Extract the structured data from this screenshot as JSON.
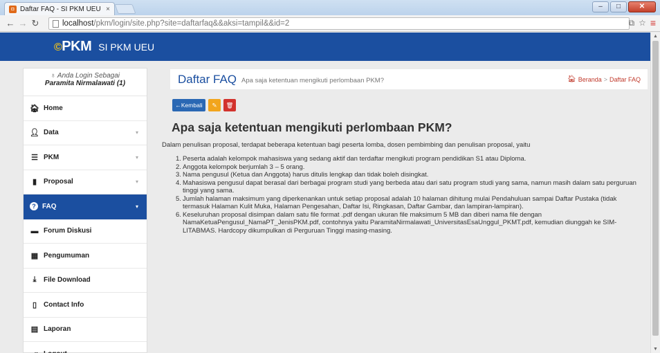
{
  "browser": {
    "tab_title": "Daftar FAQ - SI PKM UEU",
    "tab_close": "×",
    "url_host": "localhost",
    "url_rest": "/pkm/login/site.php?site=daftarfaq&&aksi=tampil&&id=2"
  },
  "header": {
    "logo_text": "PKM",
    "app_title": "SI PKM UEU"
  },
  "sidebar": {
    "login_as": "Anda Login Sebagai",
    "user_name": "Paramita Nirmalawati (1)",
    "items": [
      {
        "label": "Home",
        "icon": "home-icon",
        "caret": false,
        "active": false
      },
      {
        "label": "Data",
        "icon": "user-icon",
        "caret": true,
        "active": false
      },
      {
        "label": "PKM",
        "icon": "list-icon",
        "caret": true,
        "active": false
      },
      {
        "label": "Proposal",
        "icon": "book-icon",
        "caret": true,
        "active": false
      },
      {
        "label": "FAQ",
        "icon": "question-icon",
        "caret": true,
        "active": true
      },
      {
        "label": "Forum Diskusi",
        "icon": "comment-icon",
        "caret": false,
        "active": false
      },
      {
        "label": "Pengumuman",
        "icon": "grid-icon",
        "caret": false,
        "active": false
      },
      {
        "label": "File Download",
        "icon": "download-icon",
        "caret": false,
        "active": false
      },
      {
        "label": "Contact Info",
        "icon": "phone-icon",
        "caret": false,
        "active": false
      },
      {
        "label": "Laporan",
        "icon": "report-icon",
        "caret": false,
        "active": false
      },
      {
        "label": "Logout",
        "icon": "logout-icon",
        "caret": false,
        "active": false
      }
    ]
  },
  "content_header": {
    "title": "Daftar FAQ",
    "subtitle": "Apa saja ketentuan mengikuti perlombaan PKM?",
    "breadcrumb_home": "Beranda",
    "breadcrumb_sep": ">",
    "breadcrumb_current": "Daftar FAQ"
  },
  "actions": {
    "back_label": "Kembali"
  },
  "faq": {
    "question": "Apa saja ketentuan mengikuti perlombaan PKM?",
    "intro": "Dalam penulisan proposal, terdapat beberapa ketentuan bagi peserta lomba, dosen pembimbing dan penulisan proposal, yaitu",
    "points": [
      {
        "num": "1.",
        "text": "Peserta adalah kelompok mahasiswa yang sedang aktif dan terdaftar mengikuti program pendidikan S1 atau Diploma."
      },
      {
        "num": "2.",
        "text": "Anggota kelompok berjumlah 3 – 5 orang."
      },
      {
        "num": "3.",
        "text": "Nama pengusul (Ketua dan Anggota) harus ditulis lengkap dan tidak boleh disingkat."
      },
      {
        "num": "4.",
        "text": "Mahasiswa pengusul dapat berasal dari berbagai program studi yang berbeda atau dari satu program studi yang sama, namun masih dalam satu perguruan tinggi yang sama."
      },
      {
        "num": "5.",
        "text": "Jumlah halaman maksimum yang diperkenankan untuk setiap proposal adalah 10 halaman dihitung mulai Pendahuluan sampai Daftar Pustaka (tidak termasuk Halaman Kulit Muka, Halaman Pengesahan, Daftar Isi, Ringkasan, Daftar Gambar, dan lampiran-lampiran)."
      },
      {
        "num": "6.",
        "text": "Keseluruhan proposal disimpan dalam satu file format .pdf dengan ukuran file maksimum 5 MB dan diberi nama file dengan NamaKetuaPengusul_NamaPT_JenisPKM.pdf, contohnya yaitu ParamitaNirmalawati_UniversitasEsaUnggul_PKMT.pdf, kemudian diunggah ke SIM-LITABMAS. Hardcopy dikumpulkan di Perguruan Tinggi masing-masing."
      }
    ]
  },
  "colors": {
    "brand": "#1b4fa0",
    "edit": "#f2a51d",
    "delete": "#d2322d"
  }
}
